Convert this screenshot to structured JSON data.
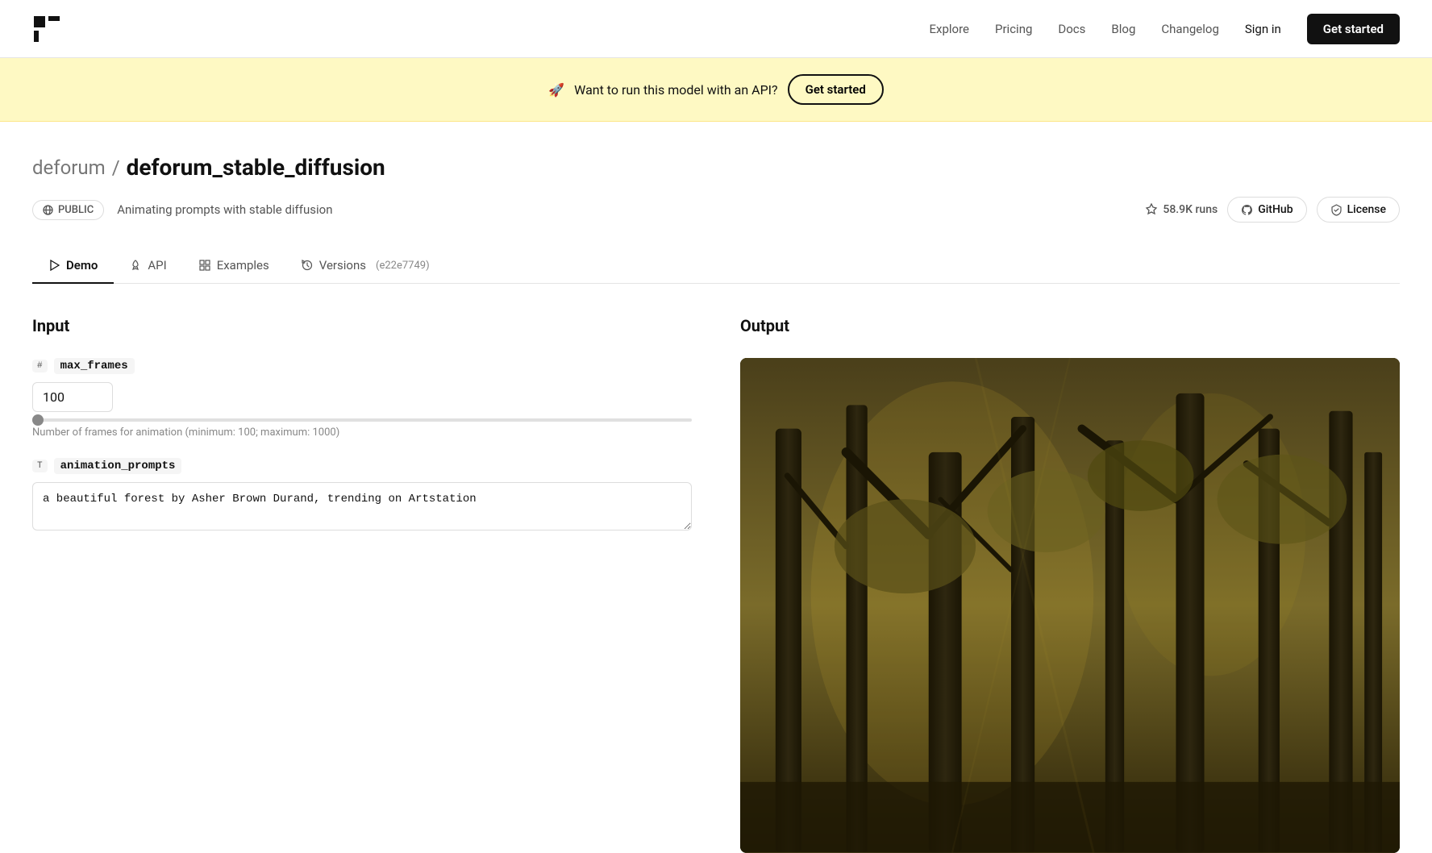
{
  "nav": {
    "logo_text": "▛▜",
    "links": [
      {
        "label": "Explore",
        "id": "explore"
      },
      {
        "label": "Pricing",
        "id": "pricing"
      },
      {
        "label": "Docs",
        "id": "docs"
      },
      {
        "label": "Blog",
        "id": "blog"
      },
      {
        "label": "Changelog",
        "id": "changelog"
      }
    ],
    "signin_label": "Sign in",
    "get_started_label": "Get started"
  },
  "banner": {
    "emoji": "🚀",
    "text": "Want to run this model with an API?",
    "button_label": "Get started"
  },
  "breadcrumb": {
    "owner": "deforum",
    "separator": "/",
    "repo": "deforum_stable_diffusion"
  },
  "meta": {
    "visibility": "PUBLIC",
    "description": "Animating prompts with stable diffusion",
    "runs": "58.9K runs",
    "github_label": "GitHub",
    "license_label": "License"
  },
  "tabs": [
    {
      "label": "Demo",
      "id": "demo",
      "active": true,
      "icon": "play-icon"
    },
    {
      "label": "API",
      "id": "api",
      "active": false,
      "icon": "rocket-icon"
    },
    {
      "label": "Examples",
      "id": "examples",
      "active": false,
      "icon": "grid-icon"
    },
    {
      "label": "Versions",
      "id": "versions",
      "active": false,
      "icon": "history-icon",
      "hash": "(e22e7749)"
    }
  ],
  "input": {
    "title": "Input",
    "fields": [
      {
        "type": "#",
        "name": "max_frames",
        "value": "100",
        "hint": "Number of frames for animation (minimum: 100; maximum: 1000)",
        "has_slider": true,
        "slider_min": 100,
        "slider_max": 1000,
        "slider_val": 0
      },
      {
        "type": "T",
        "name": "animation_prompts",
        "value": "a beautiful forest by Asher Brown Durand, trending on Artstation",
        "has_slider": false,
        "hint": ""
      }
    ]
  },
  "output": {
    "title": "Output"
  }
}
